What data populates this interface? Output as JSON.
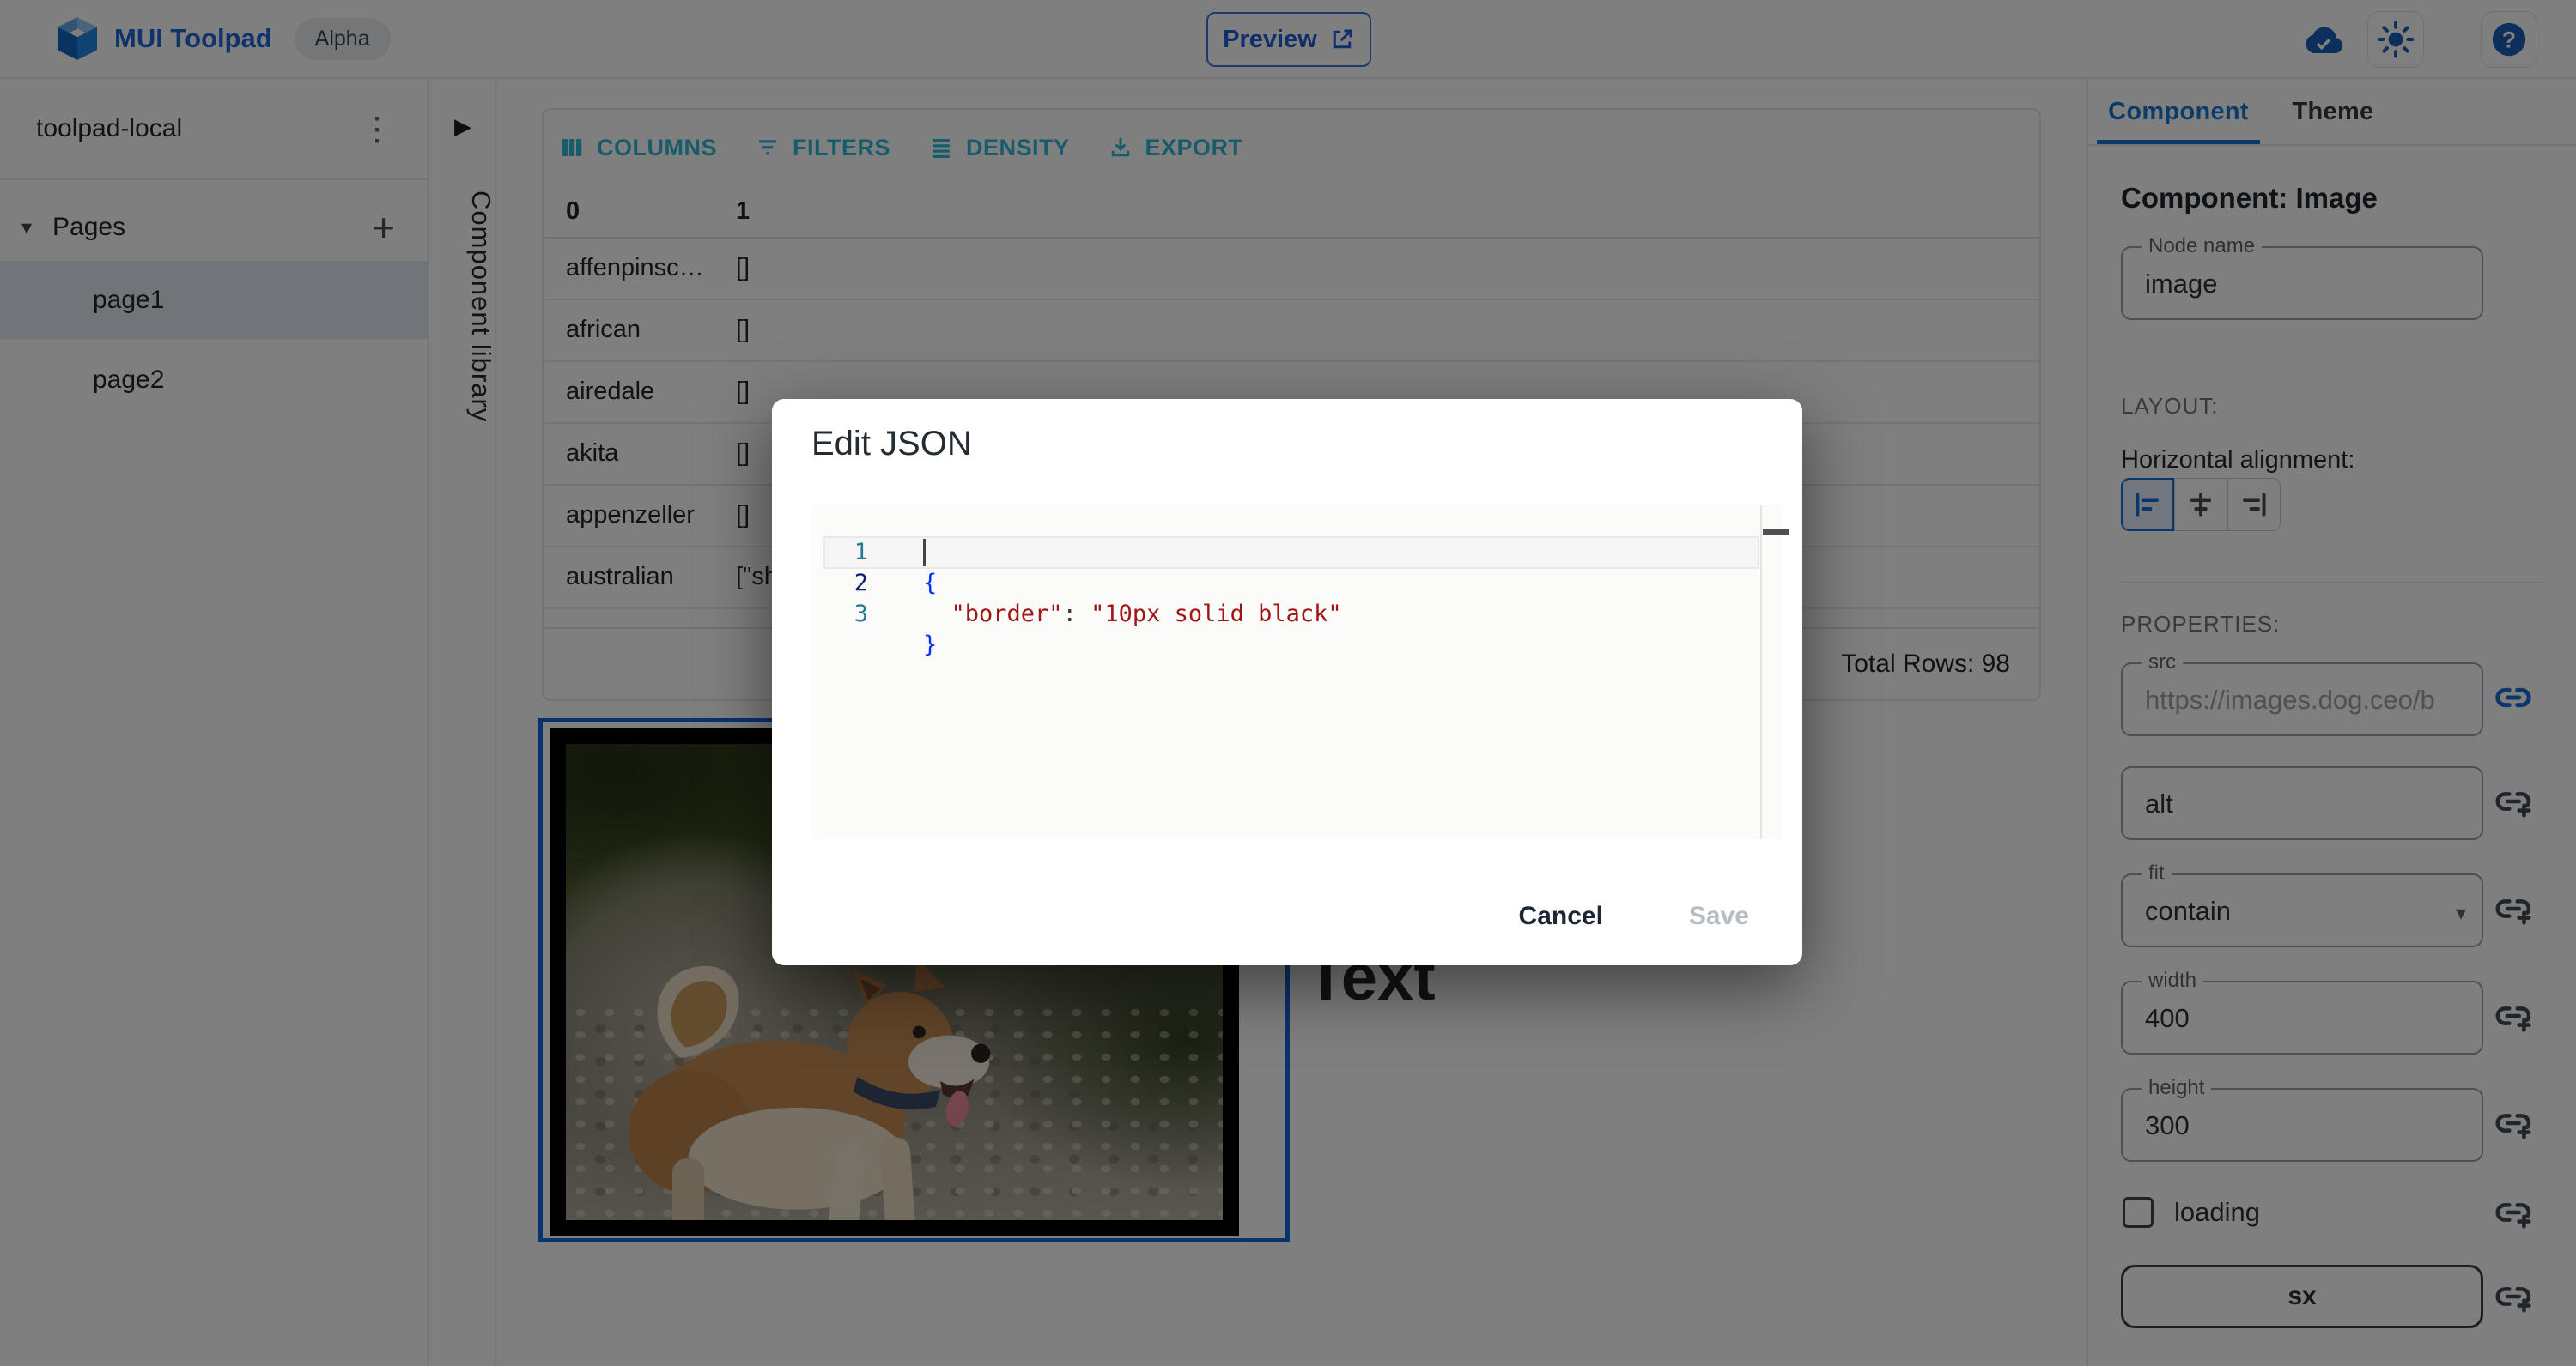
{
  "topbar": {
    "brand": "MUI Toolpad",
    "badge": "Alpha",
    "preview_label": "Preview",
    "icons": [
      "cloud-done-icon",
      "brightness-icon",
      "help-icon"
    ]
  },
  "sidebar": {
    "project": "toolpad-local",
    "section_label": "Pages",
    "pages": [
      {
        "label": "page1",
        "selected": true
      },
      {
        "label": "page2",
        "selected": false
      }
    ]
  },
  "library": {
    "label": "Component library"
  },
  "grid": {
    "toolbar_buttons": [
      {
        "label": "COLUMNS",
        "icon": "view-columns-icon"
      },
      {
        "label": "FILTERS",
        "icon": "filter-list-icon"
      },
      {
        "label": "DENSITY",
        "icon": "density-icon"
      },
      {
        "label": "EXPORT",
        "icon": "download-icon"
      }
    ],
    "columns": [
      "0",
      "1"
    ],
    "rows": [
      {
        "breed": "affenpinscher",
        "value": "[]"
      },
      {
        "breed": "african",
        "value": "[]"
      },
      {
        "breed": "airedale",
        "value": "[]"
      },
      {
        "breed": "akita",
        "value": "[]"
      },
      {
        "breed": "appenzeller",
        "value": "[]"
      },
      {
        "breed": "australian",
        "value": "[\"shepherd\"]"
      }
    ],
    "footer_total": "Total Rows: 98"
  },
  "canvas": {
    "image_component": "image",
    "text_component_label": "Text"
  },
  "dialog": {
    "title": "Edit JSON",
    "code": {
      "ln1": "1",
      "ln2": "2",
      "ln3": "3",
      "l1": "{",
      "l2_indent": "  ",
      "l2_key": "\"border\"",
      "l2_sep": ": ",
      "l2_value": "\"10px solid black\"",
      "l3": "}"
    },
    "cancel_label": "Cancel",
    "save_label": "Save"
  },
  "inspector": {
    "tabs": [
      {
        "label": "Component",
        "active": true
      },
      {
        "label": "Theme",
        "active": false
      }
    ],
    "heading": "Component: Image",
    "node_name": {
      "label": "Node name",
      "value": "image"
    },
    "layout_caption": "LAYOUT:",
    "alignment_label": "Horizontal alignment:",
    "alignment_options": [
      "align-start",
      "align-center",
      "align-end"
    ],
    "alignment_selected": "align-start",
    "properties_caption": "PROPERTIES:",
    "fields": {
      "src": {
        "label": "src",
        "value": "https://images.dog.ceo/b",
        "disabled": true,
        "icon": "link-icon"
      },
      "alt": {
        "label": "alt",
        "value": "alt",
        "icon": "add-link-icon"
      },
      "fit": {
        "label": "fit",
        "value": "contain",
        "icon": "add-link-icon"
      },
      "width": {
        "label": "width",
        "value": "400",
        "icon": "add-link-icon"
      },
      "height": {
        "label": "height",
        "value": "300",
        "icon": "add-link-icon"
      }
    },
    "loading": {
      "label": "loading",
      "checked": false,
      "icon": "add-link-icon"
    },
    "sx": {
      "label": "sx",
      "icon": "add-link-icon"
    }
  },
  "colors": {
    "brand_blue": "#2066d9",
    "grid_toolbar_teal": "#2eb8d6",
    "selection_blue": "#1565d8",
    "tab_blue": "#1976d2",
    "code_string_red": "#a31515",
    "code_brace_blue": "#0431fa",
    "code_linenum_teal": "#237893",
    "code_linenum_active": "#0b216f",
    "backdrop": "rgba(0,0,0,0.5)"
  }
}
